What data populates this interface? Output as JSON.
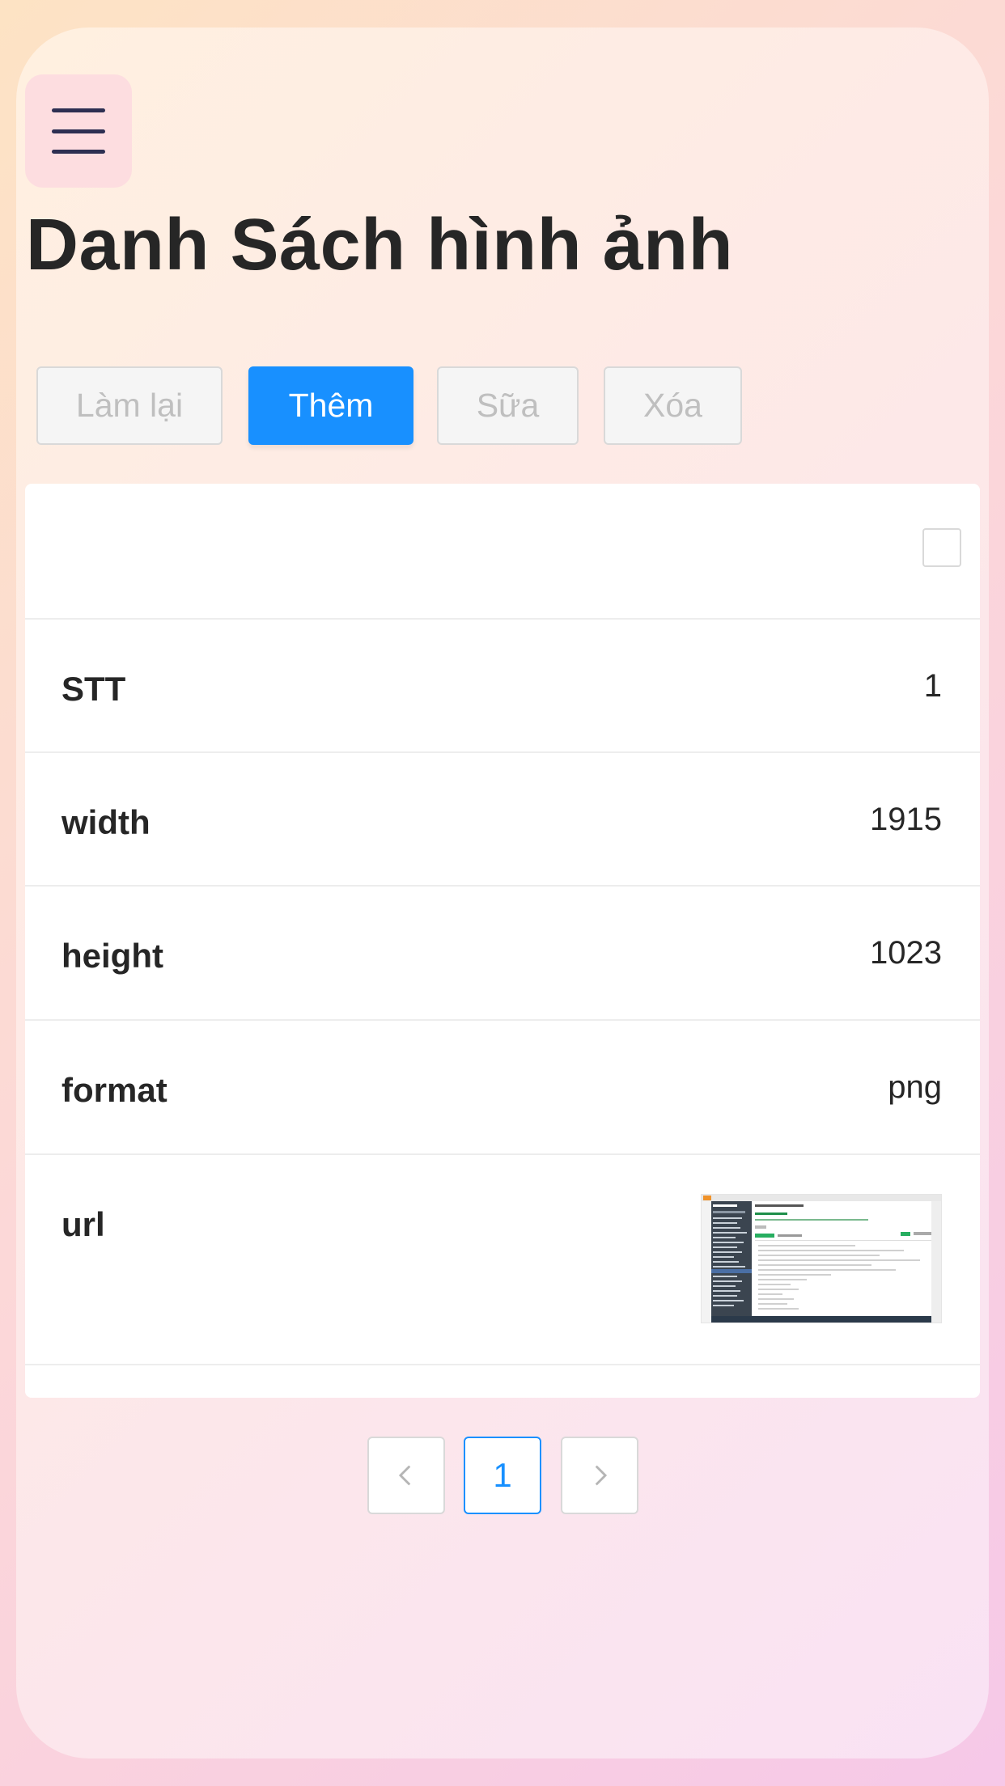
{
  "header": {
    "menu_icon": "hamburger-menu-icon",
    "title": "Danh Sách hình ảnh"
  },
  "toolbar": {
    "reset_label": "Làm lại",
    "add_label": "Thêm",
    "edit_label": "Sữa",
    "delete_label": "Xóa"
  },
  "record": {
    "fields": [
      {
        "label": "STT",
        "value": "1"
      },
      {
        "label": "width",
        "value": "1915"
      },
      {
        "label": "height",
        "value": "1023"
      },
      {
        "label": "format",
        "value": "png"
      },
      {
        "label": "url"
      }
    ],
    "checkbox_checked": false
  },
  "pagination": {
    "prev_icon": "chevron-left-icon",
    "current_page": "1",
    "next_icon": "chevron-right-icon"
  },
  "colors": {
    "primary": "#1890ff",
    "text": "#262626",
    "disabled_text": "#bfbfbf",
    "menu_bg": "#fddde0"
  }
}
